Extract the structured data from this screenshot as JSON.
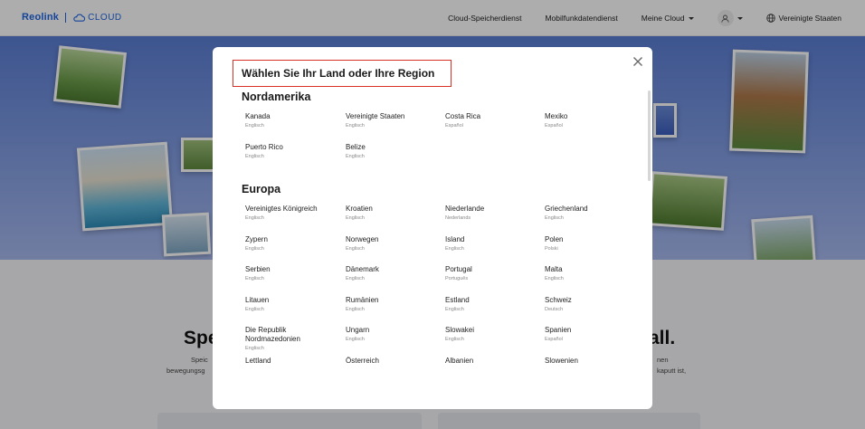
{
  "header": {
    "brand": "Reolink",
    "cloud_label": "CLOUD",
    "nav": [
      {
        "label": "Cloud-Speicherdienst"
      },
      {
        "label": "Mobilfunkdatendienst"
      },
      {
        "label": "Meine Cloud"
      }
    ],
    "region_label": "Vereinigte Staaten"
  },
  "background": {
    "heading_left": "Spe",
    "heading_right": "all.",
    "text_left_1": "Speic",
    "text_left_2": "bewegungsg",
    "text_right_1": "nen",
    "text_right_2": "kaputt ist,"
  },
  "modal": {
    "title": "Wählen Sie Ihr Land oder Ihre Region",
    "regions": [
      {
        "name": "Nordamerika",
        "countries": [
          {
            "name": "Kanada",
            "lang": "Englisch"
          },
          {
            "name": "Vereinigte Staaten",
            "lang": "Englisch"
          },
          {
            "name": "Costa Rica",
            "lang": "Español"
          },
          {
            "name": "Mexiko",
            "lang": "Español"
          },
          {
            "name": "Puerto Rico",
            "lang": "Englisch"
          },
          {
            "name": "Belize",
            "lang": "Englisch"
          }
        ]
      },
      {
        "name": "Europa",
        "countries": [
          {
            "name": "Vereinigtes Königreich",
            "lang": "Englisch"
          },
          {
            "name": "Kroatien",
            "lang": "Englisch"
          },
          {
            "name": "Niederlande",
            "lang": "Nederlands"
          },
          {
            "name": "Griechenland",
            "lang": "Englisch"
          },
          {
            "name": "Zypern",
            "lang": "Englisch"
          },
          {
            "name": "Norwegen",
            "lang": "Englisch"
          },
          {
            "name": "Island",
            "lang": "Englisch"
          },
          {
            "name": "Polen",
            "lang": "Polski"
          },
          {
            "name": "Serbien",
            "lang": "Englisch"
          },
          {
            "name": "Dänemark",
            "lang": "Englisch"
          },
          {
            "name": "Portugal",
            "lang": "Português"
          },
          {
            "name": "Malta",
            "lang": "Englisch"
          },
          {
            "name": "Litauen",
            "lang": "Englisch"
          },
          {
            "name": "Rumänien",
            "lang": "Englisch"
          },
          {
            "name": "Estland",
            "lang": "Englisch"
          },
          {
            "name": "Schweiz",
            "lang": "Deutsch"
          },
          {
            "name": "Die Republik Nordmazedonien",
            "lang": "Englisch"
          },
          {
            "name": "Ungarn",
            "lang": "Englisch"
          },
          {
            "name": "Slowakei",
            "lang": "Englisch"
          },
          {
            "name": "Spanien",
            "lang": "Español"
          },
          {
            "name": "Lettland",
            "lang": ""
          },
          {
            "name": "Österreich",
            "lang": ""
          },
          {
            "name": "Albanien",
            "lang": ""
          },
          {
            "name": "Slowenien",
            "lang": ""
          }
        ]
      }
    ]
  }
}
